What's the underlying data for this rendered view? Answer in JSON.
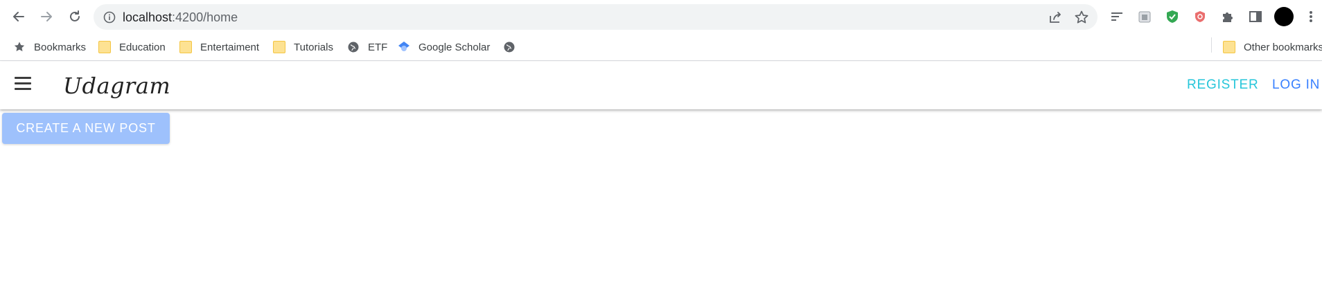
{
  "browser": {
    "url_host": "localhost",
    "url_path": ":4200/home",
    "icons": [
      "back-arrow-icon",
      "forward-arrow-icon",
      "reload-icon",
      "info-icon",
      "share-icon",
      "star-icon",
      "tab-search-icon",
      "clipboard-extension-icon",
      "shield-extension-icon",
      "adblock-extension-icon",
      "puzzle-extension-icon",
      "side-panel-icon",
      "profile-avatar",
      "more-menu-icon"
    ]
  },
  "bookmarks": {
    "items": [
      {
        "label": "Bookmarks",
        "icon": "star-icon"
      },
      {
        "label": "Education",
        "icon": "folder-icon"
      },
      {
        "label": "Entertaiment",
        "icon": "folder-icon"
      },
      {
        "label": "Tutorials",
        "icon": "folder-icon"
      },
      {
        "label": "ETF",
        "icon": "globe-icon"
      },
      {
        "label": "Google Scholar",
        "icon": "scholar-icon"
      },
      {
        "label": "",
        "icon": "globe-icon"
      }
    ],
    "other": "Other bookmarks"
  },
  "app": {
    "brand": "Udagram",
    "register": "REGISTER",
    "login": "LOG IN",
    "create_post": "CREATE A NEW POST"
  },
  "colors": {
    "register": "#26c6da",
    "login": "#3880ff",
    "create_button": "#9ec1fc"
  }
}
